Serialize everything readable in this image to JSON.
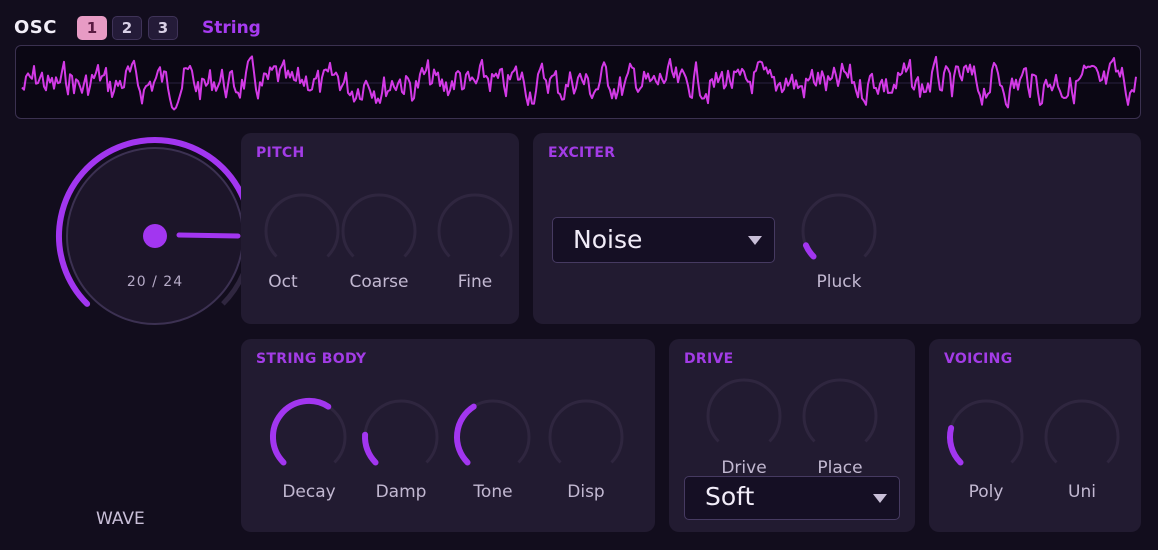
{
  "header": {
    "title": "OSC",
    "tabs": [
      {
        "label": "1",
        "active": true
      },
      {
        "label": "2",
        "active": false
      },
      {
        "label": "3",
        "active": false
      }
    ],
    "osc_type": "String"
  },
  "wave_knob": {
    "readout": "20 / 24",
    "label": "WAVE",
    "value": 20,
    "max": 24
  },
  "pitch": {
    "title": "PITCH",
    "knobs": [
      {
        "label": "Oct",
        "value": 0
      },
      {
        "label": "Coarse",
        "value": 0
      },
      {
        "label": "Fine",
        "value": 0
      }
    ]
  },
  "exciter": {
    "title": "EXCITER",
    "type_dropdown": "Noise",
    "knobs": [
      {
        "label": "Pluck",
        "value": 0.08
      }
    ]
  },
  "string_body": {
    "title": "STRING BODY",
    "knobs": [
      {
        "label": "Decay",
        "value": 0.62
      },
      {
        "label": "Damp",
        "value": 0.18
      },
      {
        "label": "Tone",
        "value": 0.38
      },
      {
        "label": "Disp",
        "value": 0
      }
    ]
  },
  "drive": {
    "title": "DRIVE",
    "knobs": [
      {
        "label": "Drive",
        "value": 0
      },
      {
        "label": "Place",
        "value": 0
      }
    ],
    "mode_dropdown": "Soft"
  },
  "voicing": {
    "title": "VOICING",
    "knobs": [
      {
        "label": "Poly",
        "value": 0.22
      },
      {
        "label": "Uni",
        "value": 0
      }
    ]
  },
  "colors": {
    "accent": "#a33ce6",
    "active_arc": "#a236f0",
    "track": "#2f263f",
    "waveform": "#d33ae6"
  }
}
